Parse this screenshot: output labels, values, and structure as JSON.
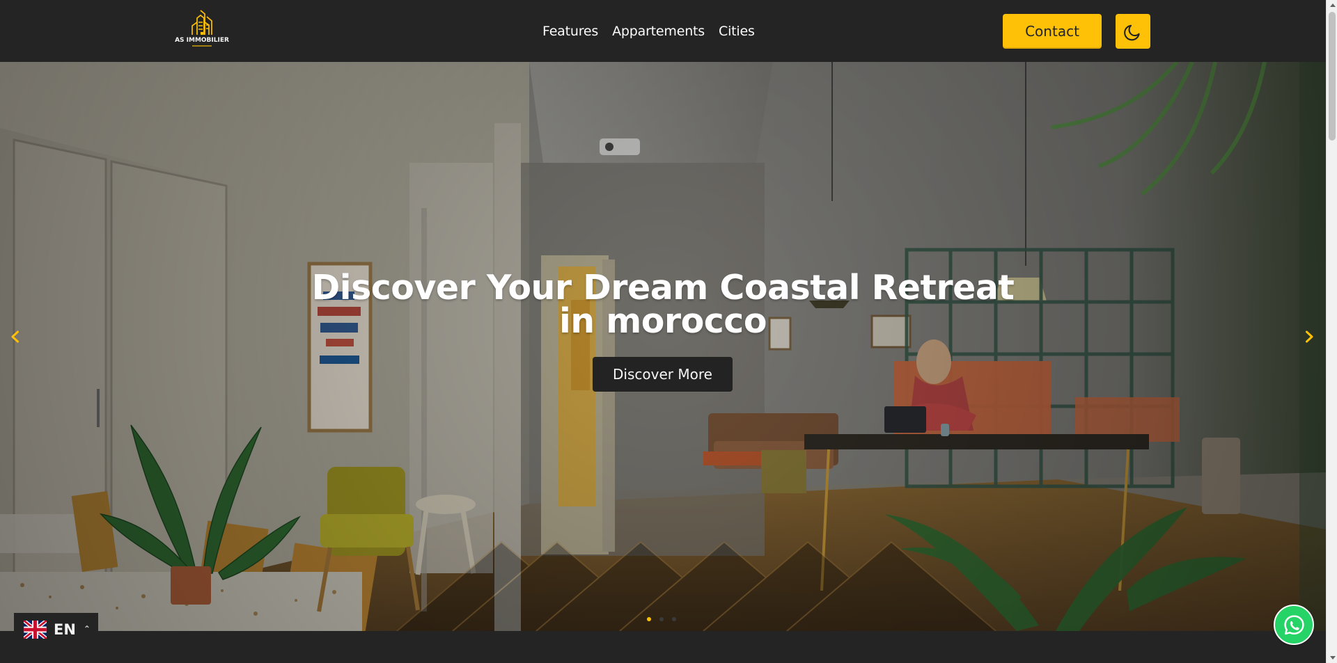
{
  "brand": {
    "name": "AS IMMOBILIER",
    "accent": "#ffc107",
    "header_bg": "#242424"
  },
  "nav": {
    "items": [
      "Features",
      "Appartements",
      "Cities"
    ],
    "contact_label": "Contact",
    "theme_toggle_icon": "moon-icon"
  },
  "hero": {
    "title": "Discover Your Dream Coastal Retreat in morocco",
    "button_label": "Discover More",
    "prev_icon": "chevron-left-icon",
    "next_icon": "chevron-right-icon",
    "slide_count": 3,
    "active_slide": 1
  },
  "language": {
    "code": "EN",
    "flag_icon": "uk-flag-icon",
    "expand_icon": "chevron-up-icon"
  },
  "chat": {
    "icon": "whatsapp-icon",
    "color": "#25d366"
  },
  "scrollbar": {
    "up_icon": "scroll-up-arrow",
    "down_icon": "scroll-down-arrow"
  }
}
